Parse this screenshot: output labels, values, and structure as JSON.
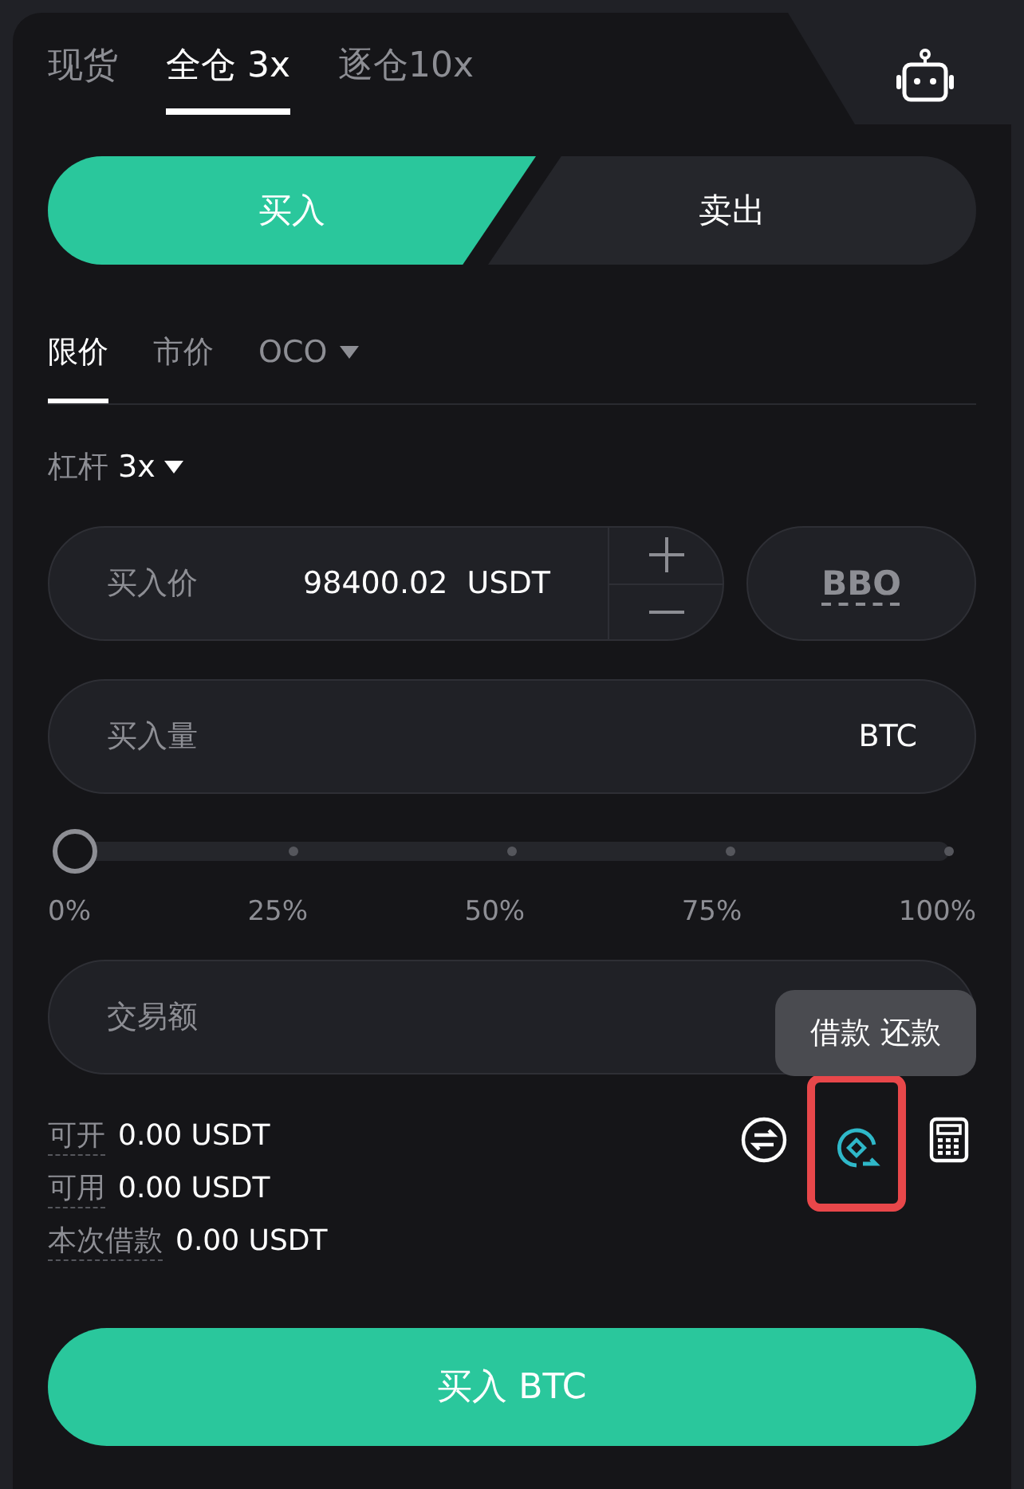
{
  "account_tabs": [
    {
      "label": "现货",
      "selected": false
    },
    {
      "label": "全仓 3x",
      "selected": true
    },
    {
      "label": "逐仓10x",
      "selected": false
    }
  ],
  "side_toggle": [
    {
      "label": "买入",
      "selected": true
    },
    {
      "label": "卖出",
      "selected": false
    }
  ],
  "order_types": [
    {
      "label": "限价",
      "selected": true,
      "dropdown": false
    },
    {
      "label": "市价",
      "selected": false,
      "dropdown": false
    },
    {
      "label": "OCO",
      "selected": false,
      "dropdown": true
    }
  ],
  "leverage": {
    "label": "杠杆",
    "value": "3x"
  },
  "price_field": {
    "label": "买入价",
    "value": "98400.02",
    "unit": "USDT"
  },
  "bbo_button": "BBO",
  "amount_field": {
    "label": "买入量",
    "unit": "BTC"
  },
  "slider": {
    "level": 0,
    "marks": [
      "0%",
      "25%",
      "50%",
      "75%",
      "100%"
    ]
  },
  "total_field": {
    "label": "交易额"
  },
  "tooltip": "借款 还款",
  "info_rows": [
    {
      "label": "可开",
      "value": "0.00 USDT"
    },
    {
      "label": "可用",
      "value": "0.00 USDT"
    },
    {
      "label": "本次借款",
      "value": "0.00 USDT"
    }
  ],
  "tools": [
    {
      "kind": "swap",
      "highlighted": false
    },
    {
      "kind": "borrow",
      "highlighted": true
    },
    {
      "kind": "calculator",
      "highlighted": false
    }
  ],
  "submit_button": "买入 BTC"
}
